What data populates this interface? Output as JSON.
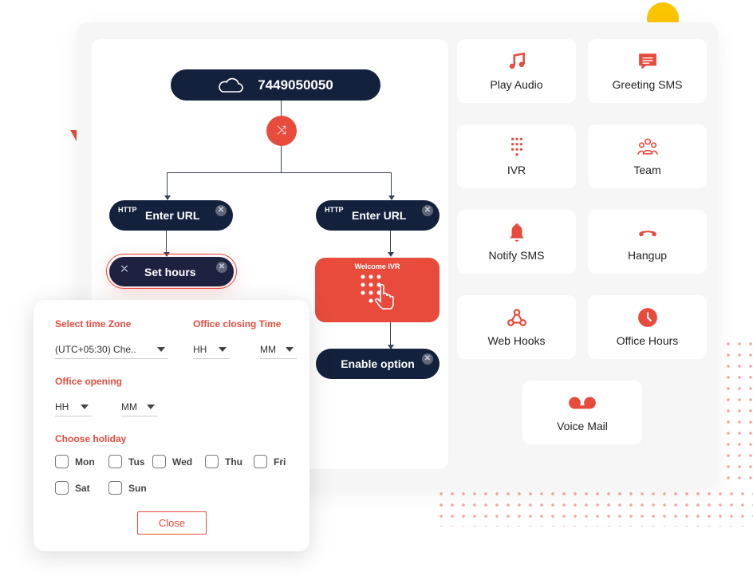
{
  "flow": {
    "phone_number": "7449050050",
    "left_url": {
      "tag": "HTTP",
      "label": "Enter URL"
    },
    "right_url": {
      "tag": "HTTP",
      "label": "Enter URL"
    },
    "set_hours": "Set hours",
    "ivr_title": "Welcome IVR",
    "enable_option": "Enable option"
  },
  "widgets": [
    {
      "label": "Play Audio",
      "icon": "music-note-icon"
    },
    {
      "label": "Greeting SMS",
      "icon": "message-icon"
    },
    {
      "label": "IVR",
      "icon": "keypad-icon"
    },
    {
      "label": "Team",
      "icon": "team-icon"
    },
    {
      "label": "Notify SMS",
      "icon": "bell-icon"
    },
    {
      "label": "Hangup",
      "icon": "hangup-phone-icon"
    },
    {
      "label": "Web Hooks",
      "icon": "webhook-icon"
    },
    {
      "label": "Office Hours",
      "icon": "clock-icon"
    },
    {
      "label": "Voice Mail",
      "icon": "voicemail-icon"
    }
  ],
  "popup": {
    "timezone_label": "Select time Zone",
    "timezone_value": "(UTC+05:30) Che..",
    "closing_label": "Office closing Time",
    "closing_hh": "HH",
    "closing_mm": "MM",
    "opening_label": "Office opening",
    "opening_hh": "HH",
    "opening_mm": "MM",
    "holiday_label": "Choose holiday",
    "days": [
      "Mon",
      "Tus",
      "Wed",
      "Thu",
      "Fri",
      "Sat",
      "Sun"
    ],
    "close_label": "Close"
  },
  "colors": {
    "accent": "#e84b3c",
    "navy": "#14213d",
    "yellow": "#fbc500"
  }
}
